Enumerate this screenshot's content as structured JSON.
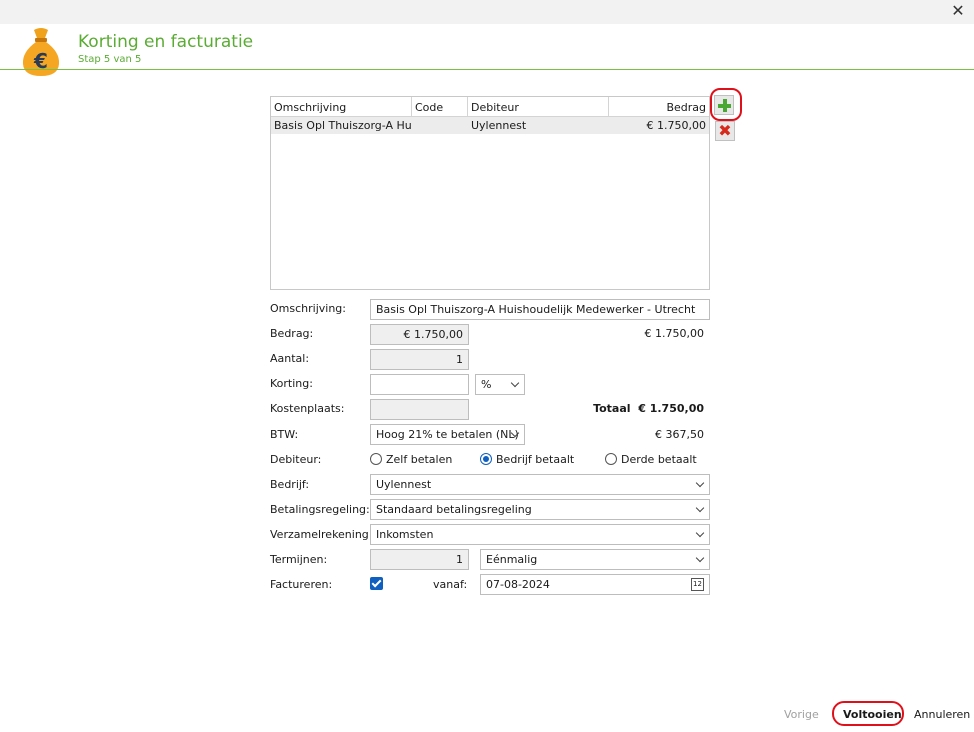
{
  "header": {
    "title": "Korting en facturatie",
    "subtitle": "Stap 5 van 5",
    "logo_symbol": "€"
  },
  "grid": {
    "columns": [
      "Omschrijving",
      "Code",
      "Debiteur",
      "Bedrag"
    ],
    "rows": [
      [
        "Basis Opl Thuiszorg-A Hui...",
        "",
        "Uylennest",
        "€ 1.750,00"
      ]
    ]
  },
  "form": {
    "omschrijving_label": "Omschrijving:",
    "omschrijving_value": "Basis Opl Thuiszorg-A Huishoudelijk Medewerker - Utrecht",
    "bedrag_label": "Bedrag:",
    "bedrag_value": "€ 1.750,00",
    "bedrag_total": "€ 1.750,00",
    "aantal_label": "Aantal:",
    "aantal_value": "1",
    "korting_label": "Korting:",
    "korting_value": "",
    "korting_unit": "%",
    "kostenplaats_label": "Kostenplaats:",
    "kostenplaats_value": "",
    "totaal_label": "Totaal",
    "totaal_value": "€ 1.750,00",
    "btw_label": "BTW:",
    "btw_value": "Hoog 21% te betalen (NL)",
    "btw_amount": "€ 367,50",
    "debiteur_label": "Debiteur:",
    "debiteur_options": [
      "Zelf betalen",
      "Bedrijf betaalt",
      "Derde betaalt"
    ],
    "debiteur_selected": "Bedrijf betaalt",
    "bedrijf_label": "Bedrijf:",
    "bedrijf_value": "Uylennest",
    "betalingsregeling_label": "Betalingsregeling:",
    "betalingsregeling_value": "Standaard betalingsregeling",
    "verzamelrekening_label": "Verzamelrekening:",
    "verzamelrekening_value": "Inkomsten",
    "termijnen_label": "Termijnen:",
    "termijnen_value": "1",
    "termijnen_type": "Eénmalig",
    "factureren_label": "Factureren:",
    "factureren_checked": true,
    "vanaf_label": "vanaf:",
    "vanaf_value": "07-08-2024",
    "calendar_day": "12"
  },
  "footer": {
    "prev_label": "Vorige",
    "finish_label": "Voltooien",
    "cancel_label": "Annuleren"
  },
  "icons": {
    "close": "close-icon",
    "add": "plus-icon",
    "delete": "delete-x-icon",
    "calendar": "calendar-icon",
    "logo": "money-bag-euro-icon"
  },
  "colors": {
    "accent_green": "#5aac33",
    "highlight_red": "#e0101a",
    "check_blue": "#0f5fc0"
  }
}
